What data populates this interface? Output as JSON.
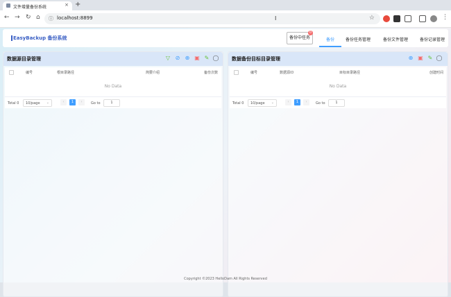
{
  "browser": {
    "tab_title": "文件增量备份系统",
    "tab_close": "×",
    "new_tab": "+",
    "url": "localhost:8899",
    "nav": {
      "back": "←",
      "forward": "→",
      "reload": "↻",
      "home": "⌂"
    },
    "star": "☆",
    "menu": "⋮"
  },
  "app": {
    "logo": "EasyBackup 备份系统",
    "task_button": "备份中任务",
    "task_count": "0",
    "menu": [
      "备份",
      "备份任务管理",
      "备份文件管理",
      "备份记录管理"
    ],
    "active_menu": "备份"
  },
  "left_panel": {
    "title": "数据源目录管理",
    "columns": [
      "编号",
      "根目录路径",
      "简要介绍",
      "备份次数"
    ],
    "empty_text": "No Data",
    "pagination": {
      "total": "Total 0",
      "page_size": "10/page",
      "current_page": "1",
      "goto": "Go to",
      "goto_value": "1"
    }
  },
  "right_panel": {
    "title": "数据备份目标目录管理",
    "columns": [
      "编号",
      "数据源ID",
      "目标目录路径",
      "创建时间"
    ],
    "empty_text": "No Data",
    "pagination": {
      "total": "Total 0",
      "page_size": "10/page",
      "current_page": "1",
      "goto": "Go to",
      "goto_value": "1"
    }
  },
  "footer": "Copyright ©2023 HelloDam All Rights Reserved",
  "colors": {
    "accent": "#409eff",
    "danger": "#f56c6c",
    "success": "#67c23a",
    "warning": "#e6a23c"
  },
  "icons": {
    "filter": "filter-icon",
    "edit": "edit-icon",
    "add": "plus-circle-icon",
    "delete": "trash-icon",
    "modify": "edit-square-icon",
    "search": "search-icon"
  }
}
